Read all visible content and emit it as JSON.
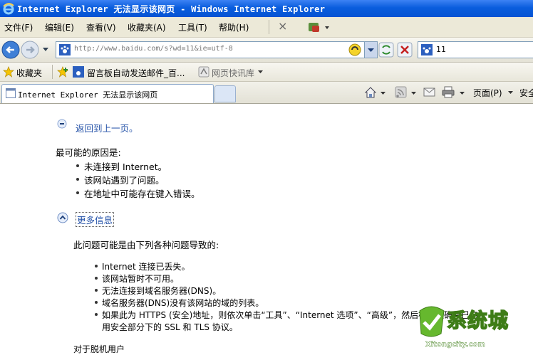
{
  "window": {
    "title": "Internet Explorer 无法显示该网页 - Windows Internet Explorer"
  },
  "menu": {
    "file": "文件(F)",
    "edit": "编辑(E)",
    "view": "查看(V)",
    "favorites": "收藏夹(A)",
    "tools": "工具(T)",
    "help": "帮助(H)",
    "close_glyph": "×"
  },
  "address": {
    "url": "http://www.baidu.com/s?wd=11&ie=utf-8",
    "search_text": "11"
  },
  "favorites_bar": {
    "favorites_label": "收藏夹",
    "item1": "留言板自动发送邮件_百...",
    "item2": "网页快讯库"
  },
  "tabs": {
    "active_label": "Internet Explorer 无法显示该网页"
  },
  "command_bar": {
    "page_label": "页面(P)",
    "safety_label": "安全"
  },
  "content": {
    "back_link": "返回到上一页。",
    "likely_causes_title": "最可能的原因是:",
    "causes": [
      "未连接到 Internet。",
      "该网站遇到了问题。",
      "在地址中可能存在键入错误。"
    ],
    "more_info": "更多信息",
    "issue_intro": "此问题可能是由下列各种问题导致的:",
    "issues": [
      "Internet 连接已丢失。",
      "该网站暂时不可用。",
      "无法连接到域名服务器(DNS)。",
      "域名服务器(DNS)没有该网站的域的列表。",
      "如果此为 HTTPS (安全)地址，则依次单击“工具”、“Internet 选项”、“高级”，然后检查以确保已启",
      "用安全部分下的 SSL 和 TLS 协议。"
    ],
    "offline_users": "对于脱机用户"
  },
  "watermark": {
    "brand": "系统城",
    "domain": "Xitongcity.com"
  }
}
